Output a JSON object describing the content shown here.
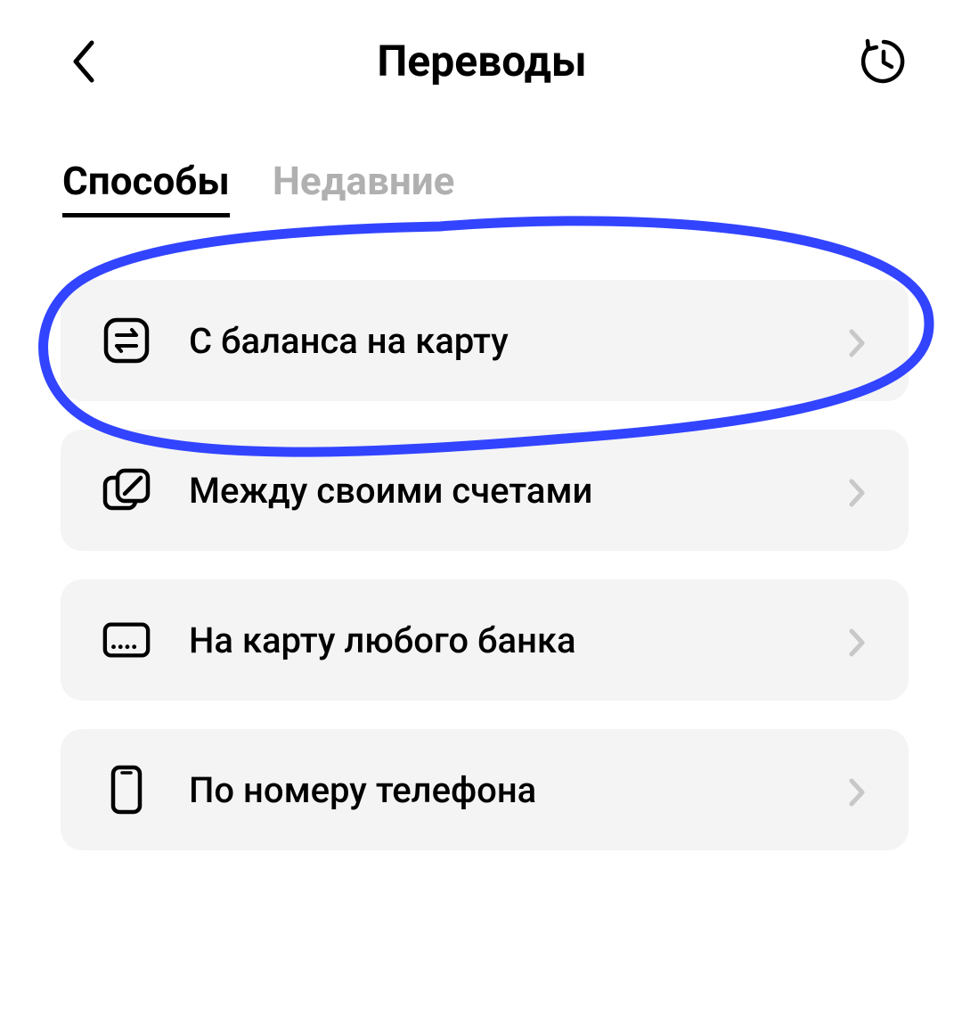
{
  "header": {
    "title": "Переводы"
  },
  "tabs": [
    {
      "label": "Способы",
      "active": true
    },
    {
      "label": "Недавние",
      "active": false
    }
  ],
  "options": [
    {
      "icon": "transfer-icon",
      "label": "С баланса на карту"
    },
    {
      "icon": "between-accounts-icon",
      "label": "Между своими счетами"
    },
    {
      "icon": "card-icon",
      "label": "На карту любого банка"
    },
    {
      "icon": "phone-icon",
      "label": "По номеру телефона"
    }
  ],
  "annotation": {
    "color": "#3244ff",
    "target_option_index": 0
  }
}
